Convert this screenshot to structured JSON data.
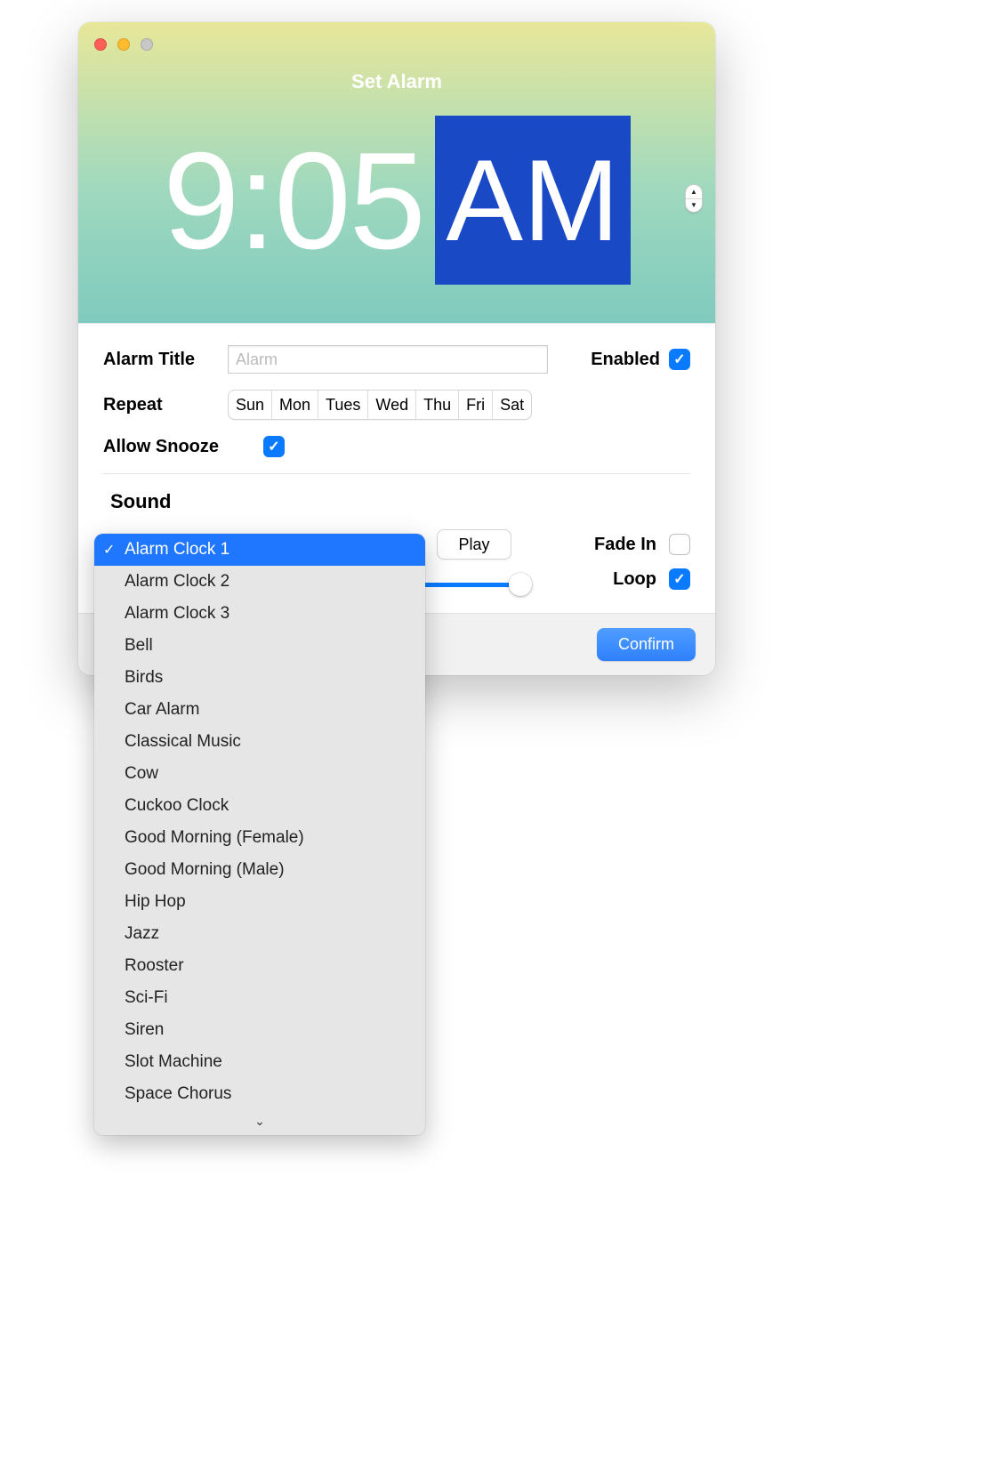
{
  "header": {
    "title": "Set Alarm",
    "time": "9:05",
    "ampm": "AM"
  },
  "form": {
    "alarm_title_label": "Alarm Title",
    "alarm_title_placeholder": "Alarm",
    "enabled_label": "Enabled",
    "enabled_checked": true,
    "repeat_label": "Repeat",
    "repeat_days": [
      "Sun",
      "Mon",
      "Tues",
      "Wed",
      "Thu",
      "Fri",
      "Sat"
    ],
    "allow_snooze_label": "Allow Snooze",
    "allow_snooze_checked": true
  },
  "sound": {
    "section_label": "Sound",
    "play_label": "Play",
    "fade_in_label": "Fade In",
    "fade_in_checked": false,
    "loop_label": "Loop",
    "loop_checked": true,
    "selected": "Alarm Clock 1",
    "options": [
      "Alarm Clock 1",
      "Alarm Clock 2",
      "Alarm Clock 3",
      "Bell",
      "Birds",
      "Car Alarm",
      "Classical Music",
      "Cow",
      "Cuckoo Clock",
      "Good Morning (Female)",
      "Good Morning (Male)",
      "Hip Hop",
      "Jazz",
      "Rooster",
      "Sci-Fi",
      "Siren",
      "Slot Machine",
      "Space Chorus"
    ]
  },
  "footer": {
    "confirm_label": "Confirm"
  }
}
